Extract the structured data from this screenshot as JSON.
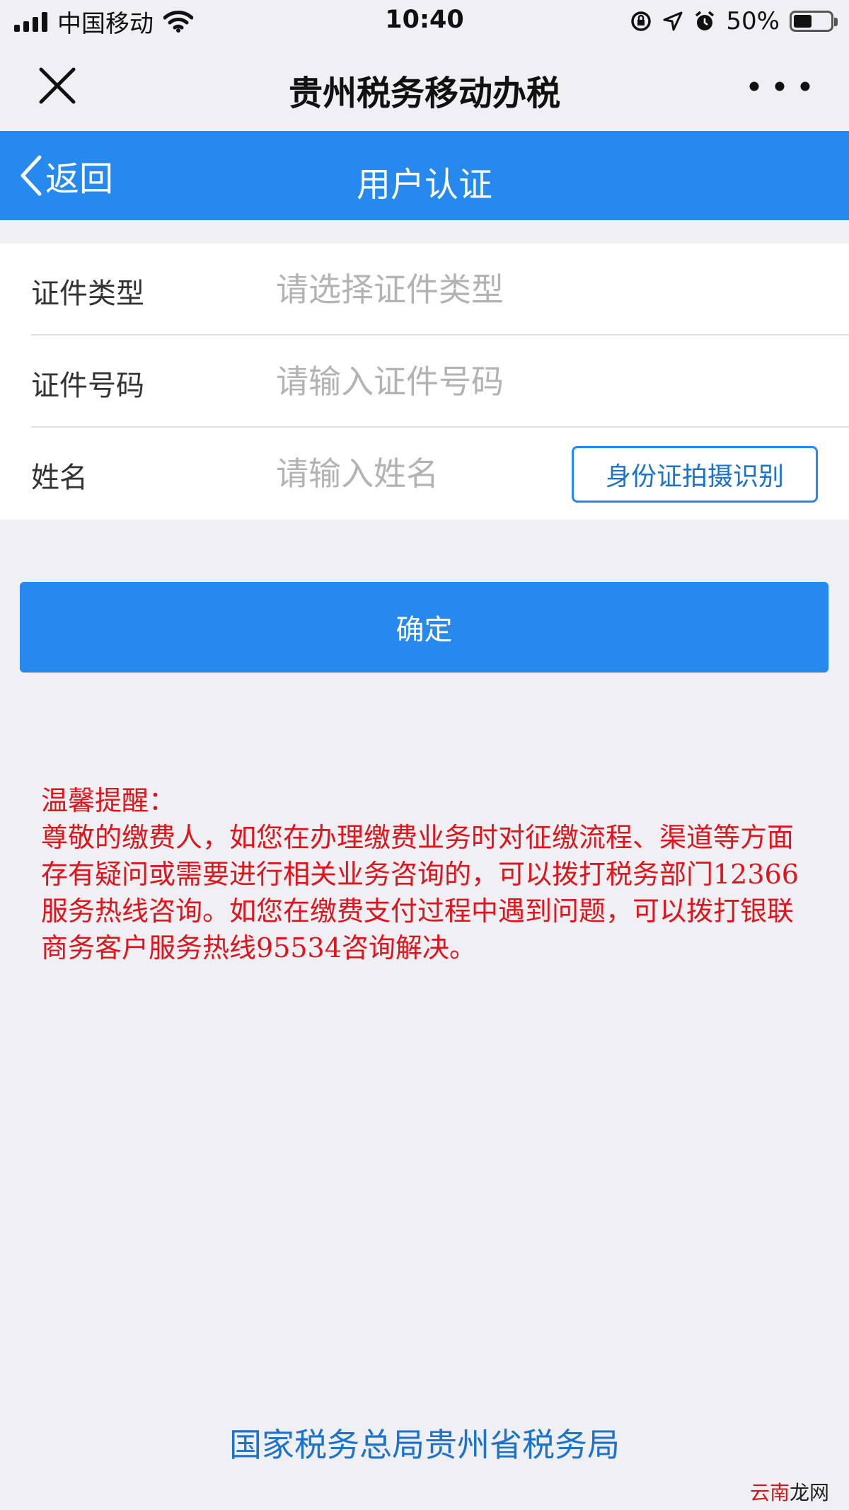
{
  "status_bar": {
    "carrier": "中国移动",
    "time": "10:40",
    "battery": "50%",
    "battery_level": 0.5
  },
  "wechat_nav": {
    "title": "贵州税务移动办税",
    "close_icon": "close-icon",
    "more_icon": "more-icon"
  },
  "header": {
    "back_label": "返回",
    "title": "用户认证",
    "color": "#2589ee"
  },
  "form": {
    "rows": [
      {
        "label": "证件类型",
        "placeholder": "请选择证件类型",
        "value": ""
      },
      {
        "label": "证件号码",
        "placeholder": "请输入证件号码",
        "value": ""
      },
      {
        "label": "姓名",
        "placeholder": "请输入姓名",
        "value": ""
      }
    ],
    "id_scan_label": "身份证拍摄识别"
  },
  "confirm_label": "确定",
  "notice": {
    "title": "温馨提醒：",
    "body": "尊敬的缴费人，如您在办理缴费业务时对征缴流程、渠道等方面存有疑问或需要进行相关业务咨询的，可以拨打税务部门12366服务热线咨询。如您在缴费支付过程中遇到问题，可以拨打银联商务客户服务热线95534咨询解决。",
    "color": "#e0151b"
  },
  "footer": {
    "org": "国家税务总局贵州省税务局"
  },
  "watermark": {
    "part1": "云南",
    "part2": "龙网"
  }
}
